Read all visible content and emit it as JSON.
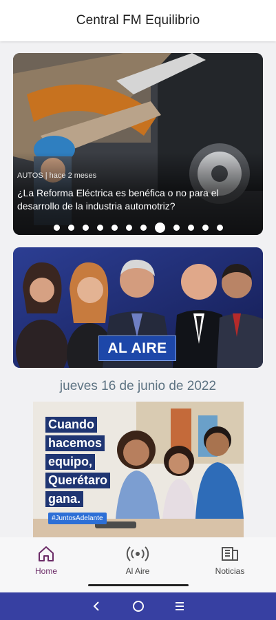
{
  "app": {
    "title": "Central FM Equilibrio"
  },
  "slider": {
    "category_time": "AUTOS | hace 2 meses",
    "headline": "¿La Reforma Eléctrica es benéfica o no para el desarrollo de la industria automotriz?",
    "dots_count": 12,
    "active_dot_index": 7
  },
  "banner": {
    "label": "AL AIRE"
  },
  "date": "jueves 16 de junio de 2022",
  "ad": {
    "lines": [
      "Cuando",
      "hacemos",
      "equipo,",
      "Querétaro",
      "gana."
    ],
    "hashtag": "#JuntosAdelante"
  },
  "bottom_nav": {
    "items": [
      {
        "label": "Home",
        "icon": "home-icon",
        "active": true
      },
      {
        "label": "Al Aire",
        "icon": "broadcast-icon",
        "active": false
      },
      {
        "label": "Noticias",
        "icon": "newspaper-icon",
        "active": false
      }
    ]
  },
  "colors": {
    "active_nav": "#6b2b67",
    "system_nav": "#3740a2",
    "ad_text_bg": "#1f3572"
  }
}
